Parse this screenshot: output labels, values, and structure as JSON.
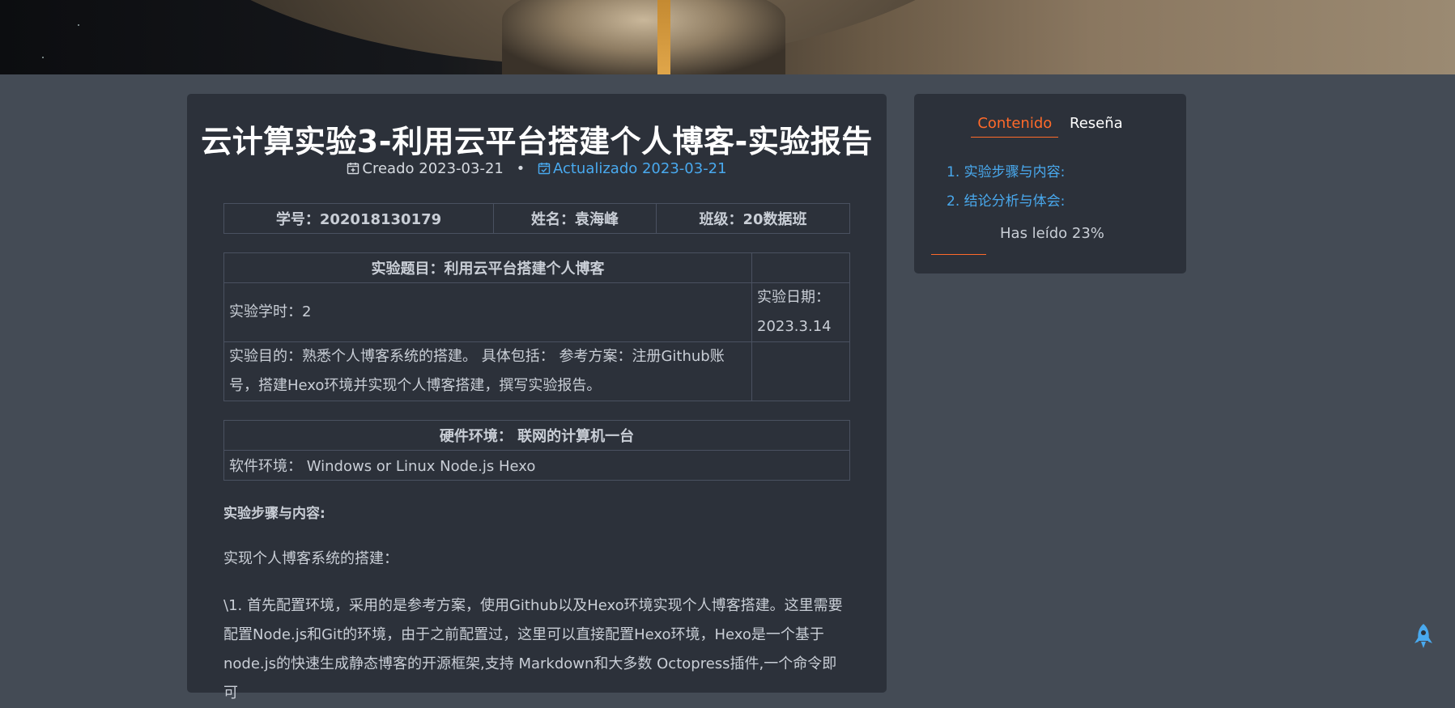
{
  "post": {
    "title": "云计算实验3-利用云平台搭建个人博客-实验报告",
    "created_label": "Creado 2023-03-21",
    "updated_label": "Actualizado 2023-03-21",
    "separator": "•"
  },
  "info_table": {
    "student_id": "学号：202018130179",
    "name": "姓名：袁海峰",
    "class": "班级：20数据班"
  },
  "experiment_table": {
    "header": "实验题目：利用云平台搭建个人博客",
    "hours": "实验学时：2",
    "date_label": "实验日期：",
    "date_value": "2023.3.14",
    "purpose_line1": "实验目的：熟悉个人博客系统的搭建。 具体包括： 参考方案：注册Github账",
    "purpose_line2": "号，搭建Hexo环境并实现个人博客搭建，撰写实验报告。"
  },
  "env_table": {
    "hardware": "硬件环境： 联网的计算机一台",
    "software": "软件环境： Windows or Linux Node.js Hexo"
  },
  "content": {
    "section_heading": "实验步骤与内容:",
    "para1": "实现个人博客系统的搭建：",
    "para2_line1": "\\1. 首先配置环境，采用的是参考方案，使用Github以及Hexo环境实现个人博客搭建。这里需要",
    "para2_line2": "配置Node.js和Git的环境，由于之前配置过，这里可以直接配置Hexo环境，Hexo是一个基于",
    "para2_line3": "node.js的快速生成静态博客的开源框架,支持 Markdown和大多数 Octopress插件,一个命令即可"
  },
  "sidebar": {
    "tabs": [
      {
        "label": "Contenido",
        "active": true
      },
      {
        "label": "Reseña",
        "active": false
      }
    ],
    "toc": [
      {
        "label": "1. 实验步骤与内容:"
      },
      {
        "label": "2. 结论分析与体会:"
      }
    ],
    "read_text": "Has leído 23%",
    "read_progress": 0.23
  },
  "colors": {
    "accent": "#ff6a2a",
    "link": "#49a9ee",
    "card": "#2c313a",
    "background": "#444b55"
  },
  "icons": {
    "created": "calendar-plus-icon",
    "updated": "calendar-check-icon",
    "back_to_top": "rocket-icon"
  }
}
